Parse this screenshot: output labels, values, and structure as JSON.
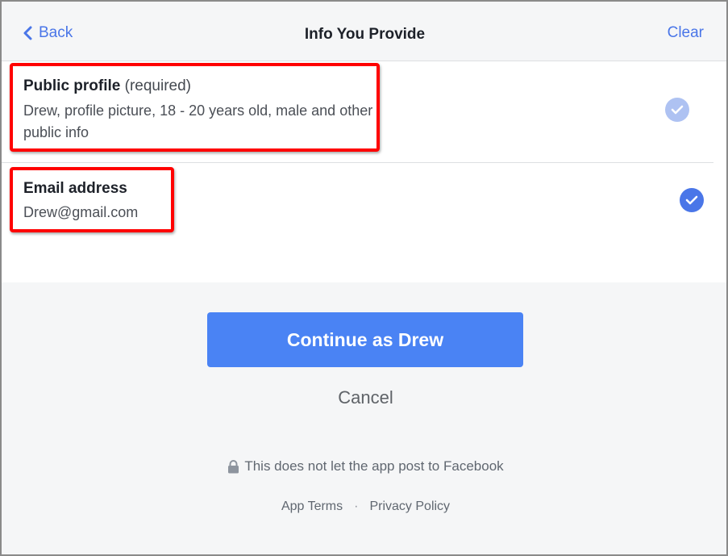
{
  "header": {
    "back_label": "Back",
    "title": "Info You Provide",
    "clear_label": "Clear"
  },
  "items": [
    {
      "title": "Public profile",
      "qualifier": "(required)",
      "detail": "Drew, profile picture, 18 - 20 years old, male and other public info",
      "checked": true,
      "disabled": true
    },
    {
      "title": "Email address",
      "detail": "Drew@gmail.com",
      "checked": true,
      "disabled": false
    }
  ],
  "actions": {
    "continue_label": "Continue as Drew",
    "cancel_label": "Cancel"
  },
  "footer": {
    "note": "This does not let the app post to Facebook",
    "app_terms": "App Terms",
    "separator": "·",
    "privacy": "Privacy Policy"
  },
  "colors": {
    "accent": "#4a76e8",
    "button": "#4a83f4",
    "highlight": "#ff0000"
  }
}
